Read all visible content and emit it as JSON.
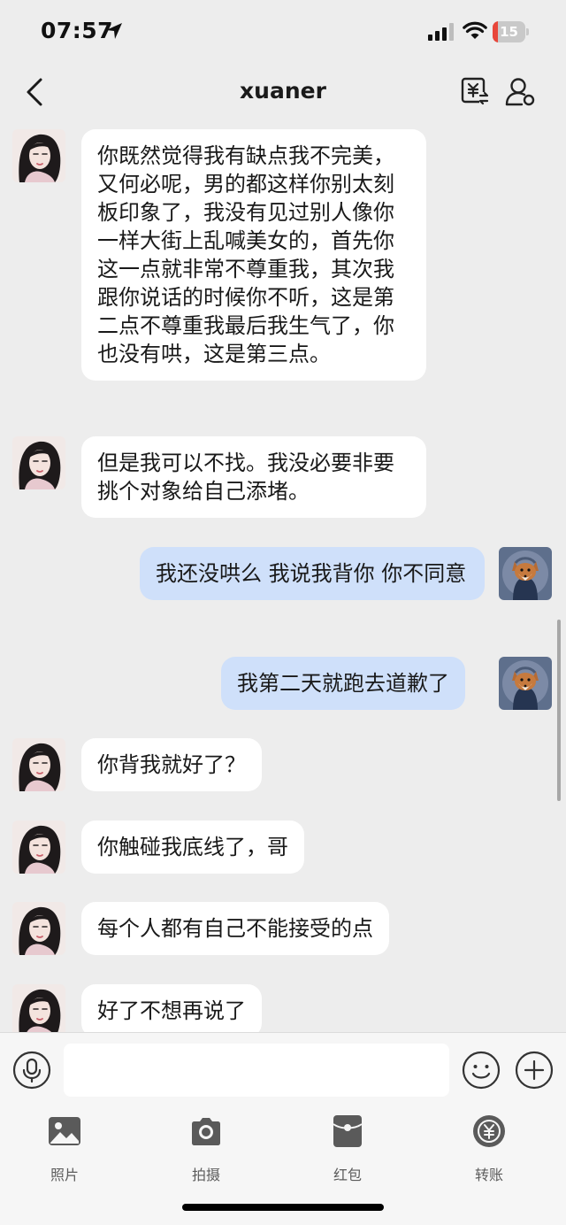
{
  "status_bar": {
    "time": "07:57",
    "battery": "15",
    "battery_level": 0.15,
    "battery_color": "#e8463a"
  },
  "nav": {
    "title": "xuaner"
  },
  "messages": [
    {
      "side": "in",
      "text": "你既然觉得我有缺点我不完美，又何必呢，男的都这样你别太刻板印象了，我没有见过别人像你一样大街上乱喊美女的，首先你这一点就非常不尊重我，其次我跟你说话的时候你不听，这是第二点不尊重我最后我生气了，你也没有哄，这是第三点。"
    },
    {
      "side": "in",
      "text": "但是我可以不找。我没必要非要挑个对象给自己添堵。"
    },
    {
      "side": "out",
      "text": "我还没哄么 我说我背你 你不同意"
    },
    {
      "side": "out",
      "text": "我第二天就跑去道歉了"
    },
    {
      "side": "in",
      "text": "你背我就好了？"
    },
    {
      "side": "in",
      "text": "你触碰我底线了，哥"
    },
    {
      "side": "in",
      "text": "每个人都有自己不能接受的点"
    },
    {
      "side": "in",
      "text": "好了不想再说了"
    }
  ],
  "input": {
    "value": "",
    "placeholder": ""
  },
  "tools": [
    {
      "label": "照片",
      "icon": "photo-icon"
    },
    {
      "label": "拍摄",
      "icon": "camera-icon"
    },
    {
      "label": "红包",
      "icon": "red-packet-icon"
    },
    {
      "label": "转账",
      "icon": "transfer-icon"
    }
  ],
  "colors": {
    "background": "#ededed",
    "incoming_bubble": "#ffffff",
    "outgoing_bubble": "#cfe0fa",
    "icon_gray": "#555555"
  }
}
